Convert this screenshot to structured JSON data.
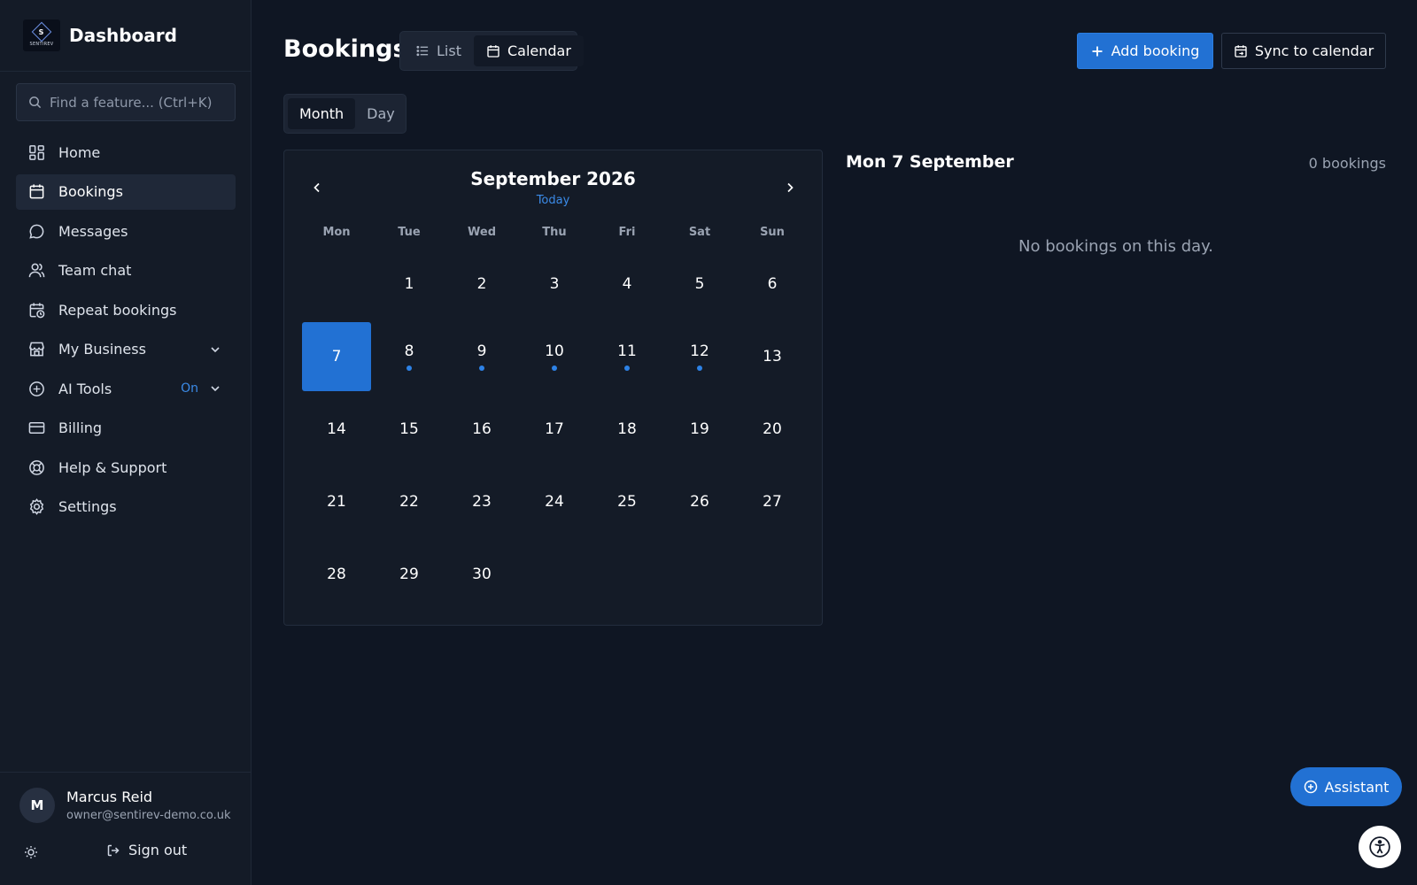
{
  "brand": {
    "logo_letter": "S",
    "logo_text": "SENTIREV",
    "title": "Dashboard"
  },
  "search": {
    "placeholder": "Find a feature... (Ctrl+K)"
  },
  "sidebar": {
    "items": [
      {
        "label": "Home",
        "icon": "grid-icon"
      },
      {
        "label": "Bookings",
        "icon": "calendar-icon",
        "active": true
      },
      {
        "label": "Messages",
        "icon": "message-icon"
      },
      {
        "label": "Team chat",
        "icon": "users-icon"
      },
      {
        "label": "Repeat bookings",
        "icon": "calendar-clock-icon"
      },
      {
        "label": "My Business",
        "icon": "store-icon"
      },
      {
        "label": "AI Tools",
        "icon": "ai-icon",
        "badge": "On"
      },
      {
        "label": "Billing",
        "icon": "card-icon"
      },
      {
        "label": "Help & Support",
        "icon": "lifebuoy-icon"
      },
      {
        "label": "Settings",
        "icon": "gear-icon"
      }
    ]
  },
  "user": {
    "initial": "M",
    "name": "Marcus Reid",
    "email": "owner@sentirev-demo.co.uk",
    "sign_out": "Sign out"
  },
  "header": {
    "title": "Bookings",
    "view_list": "List",
    "view_calendar": "Calendar",
    "add_booking": "Add booking",
    "sync": "Sync to calendar"
  },
  "period": {
    "month": "Month",
    "day": "Day"
  },
  "calendar": {
    "title": "September 2026",
    "today": "Today",
    "weekdays": [
      "Mon",
      "Tue",
      "Wed",
      "Thu",
      "Fri",
      "Sat",
      "Sun"
    ],
    "selected_day": 7,
    "days_with_bookings": [
      8,
      9,
      10,
      11,
      12
    ],
    "days": [
      "",
      "1",
      "2",
      "3",
      "4",
      "5",
      "6",
      "7",
      "8",
      "9",
      "10",
      "11",
      "12",
      "13",
      "14",
      "15",
      "16",
      "17",
      "18",
      "19",
      "20",
      "21",
      "22",
      "23",
      "24",
      "25",
      "26",
      "27",
      "28",
      "29",
      "30",
      "",
      "",
      "",
      ""
    ]
  },
  "day_panel": {
    "title": "Mon 7 September",
    "count": "0 bookings",
    "empty": "No bookings on this day."
  },
  "assistant": {
    "label": "Assistant"
  },
  "colors": {
    "accent": "#2271d3",
    "background": "#0f1623",
    "sidebar": "#141b27"
  }
}
